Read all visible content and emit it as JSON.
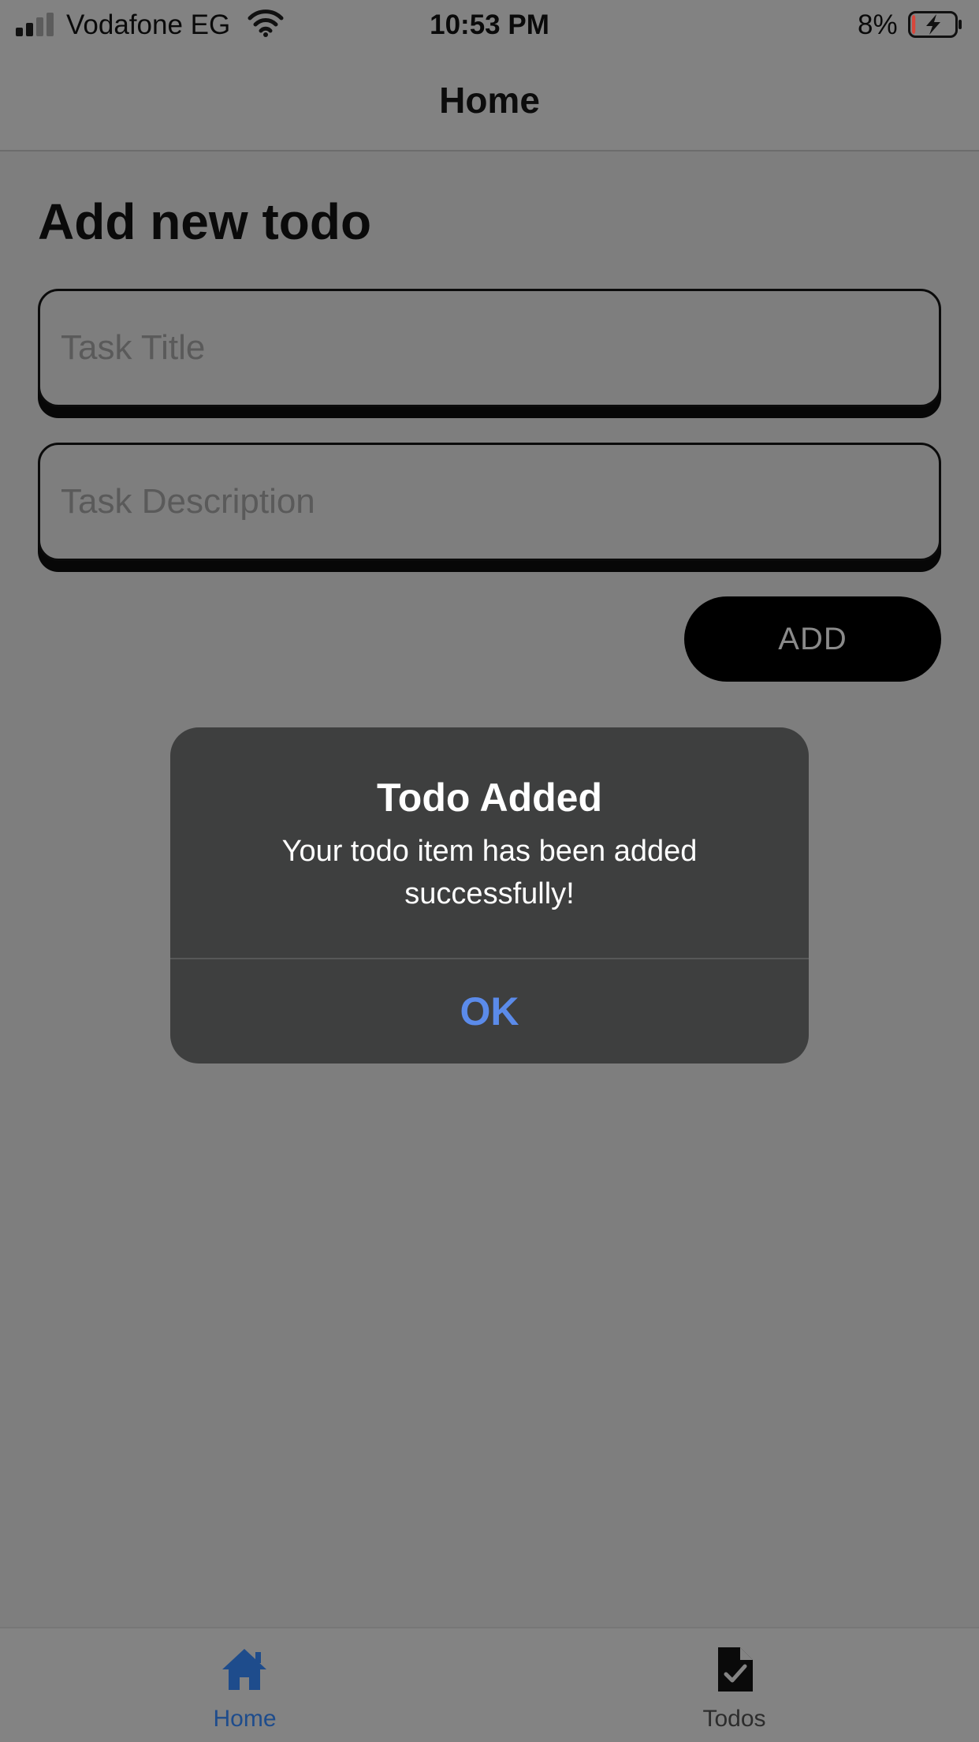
{
  "status_bar": {
    "carrier": "Vodafone EG",
    "time": "10:53 PM",
    "battery_percent": "8%",
    "battery_level": 0.08,
    "icons": [
      "signal-icon",
      "wifi-icon",
      "battery-charging-icon"
    ]
  },
  "nav": {
    "title": "Home"
  },
  "form": {
    "heading": "Add new todo",
    "title_placeholder": "Task Title",
    "title_value": "",
    "description_placeholder": "Task Description",
    "description_value": "",
    "add_label": "ADD"
  },
  "dialog": {
    "title": "Todo Added",
    "message": "Your todo item has been added successfully!",
    "ok_label": "OK"
  },
  "tabs": [
    {
      "label": "Home",
      "icon": "home-icon",
      "selected": true
    },
    {
      "label": "Todos",
      "icon": "document-check-icon",
      "selected": false
    }
  ],
  "colors": {
    "overlay_background": "#7e7e7e",
    "dialog_background": "#3e3f3f",
    "dialog_action": "#5b8bea",
    "active_tab": "#1e4c8c",
    "button_background": "#000000",
    "battery_low": "#d9463b"
  }
}
